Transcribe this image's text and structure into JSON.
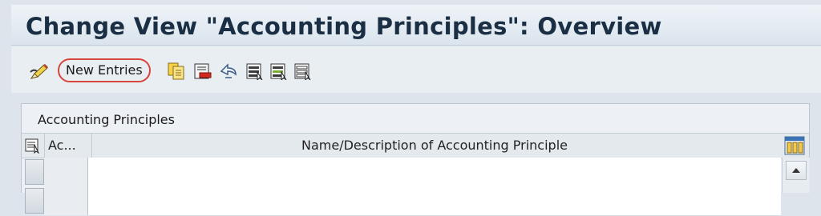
{
  "window": {
    "title": "Change View \"Accounting Principles\": Overview"
  },
  "toolbar": {
    "new_entries_label": "New Entries",
    "icons": [
      "edit-pen-icon",
      "copy-icon",
      "delete-icon",
      "undo-icon",
      "select-all-icon",
      "select-block-icon",
      "deselect-all-icon"
    ]
  },
  "table": {
    "title": "Accounting Principles",
    "columns": [
      "Ac...",
      "Name/Description of Accounting Principle"
    ],
    "rows": [
      {
        "ac": "",
        "name": ""
      },
      {
        "ac": "",
        "name": ""
      }
    ]
  },
  "colors": {
    "title_text": "#1b2f44",
    "highlight_ring": "#d8453a",
    "background": "#dde4ec"
  }
}
